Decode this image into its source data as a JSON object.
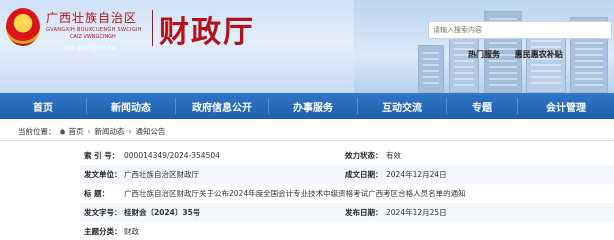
{
  "header": {
    "region_cn": "广西壮族自治区",
    "region_en_line1": "GVANGXIH BOUXCUENGH SWCIGIH",
    "region_en_line2": "CAIZ VWNGCINGH",
    "department": "财政厅",
    "site_url": "czt.gxzf.gov.cn",
    "search_placeholder": "请输入搜索内容",
    "hot_label": "热门服务",
    "hot_link": "惠民惠农补贴"
  },
  "nav": {
    "items": [
      {
        "label": "首页"
      },
      {
        "label": "新闻动态"
      },
      {
        "label": "政府信息公开"
      },
      {
        "label": "办事服务"
      },
      {
        "label": "互动交流"
      },
      {
        "label": "专题"
      },
      {
        "label": "会计管理"
      }
    ]
  },
  "breadcrumb": {
    "prefix": "当前位置：",
    "items": [
      "首页",
      "新闻动态",
      "通知公告"
    ]
  },
  "info": {
    "rows": [
      {
        "lk": "索  引  号：",
        "lv": "000014349/2024-354504",
        "rk": "效力状态：",
        "rv": "有效"
      },
      {
        "lk": "发文单位：",
        "lv": "广西壮族自治区财政厅",
        "rk": "成文日期：",
        "rv": "2024年12月24日"
      },
      {
        "lk": "标        题：",
        "lv": "广西壮族自治区财政厅关于公布2024年度全国会计专业技术中级资格考试广西考区合格人员名单的通知"
      },
      {
        "lk": "发文字号：",
        "lv": "桂财会〔2024〕35号",
        "rk": "发布日期：",
        "rv": "2024年12月25日"
      },
      {
        "lk": "主题分类：",
        "lv": "财政"
      }
    ]
  },
  "colors": {
    "brand_red": "#b4121a",
    "nav_blue": "#2166b8"
  }
}
